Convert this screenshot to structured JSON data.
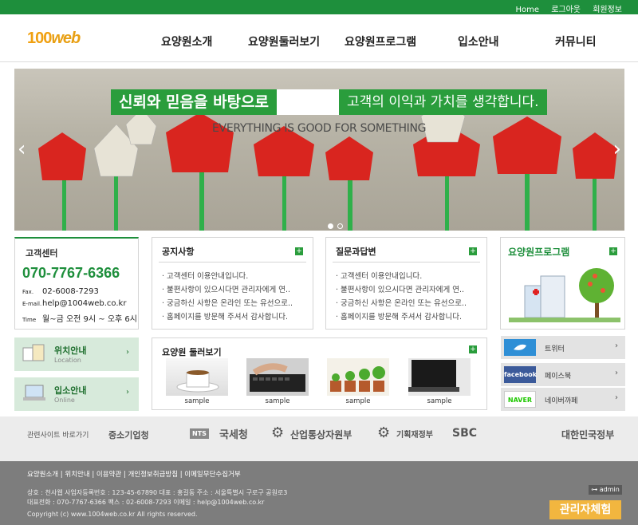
{
  "top_links": [
    "Home",
    "로그아웃",
    "회원정보"
  ],
  "logo": {
    "num": "100",
    "web": "web"
  },
  "nav": [
    "요양원소개",
    "요양원둘러보기",
    "요양원프로그램",
    "입소안내",
    "커뮤니티"
  ],
  "banner": {
    "headline_a": "신뢰와 믿음을 바탕으로",
    "headline_b": "고객의 이익과 가치를 생각합니다.",
    "sub": "EVERYTHING IS GOOD FOR SOMETHING"
  },
  "customer_center": {
    "title": "고객센터",
    "phone": "070-7767-6366",
    "fax_label": "Fax.",
    "fax": "02-6008-7293",
    "email_label": "E-mail.",
    "email": "help@1004web.co.kr",
    "time_label": "Time",
    "time": "월~금 오전 9시 ~ 오후 6시"
  },
  "location": {
    "title": "위치안내",
    "sub": "Location",
    "chevron": "›"
  },
  "admission": {
    "title": "입소안내",
    "sub": "Online",
    "chevron": "›"
  },
  "notice": {
    "title": "공지사항",
    "plus": "+",
    "items": [
      "· 고객센터 이용안내입니다.",
      "· 불편사항이 있으시다면 관리자에게 연..",
      "· 궁금하신 사항은 온라인 또는 유선으로..",
      "· 홈페이지를 방문해 주셔서 감사합니다."
    ]
  },
  "qna": {
    "title": "질문과답변",
    "plus": "+",
    "items": [
      "· 고객센터 이용안내입니다.",
      "· 불편사항이 있으시다면 관리자에게 연..",
      "· 궁금하신 사항은 온라인 또는 유선으로..",
      "· 홈페이지를 방문해 주셔서 감사합니다."
    ]
  },
  "program": {
    "title": "요양원프로그램",
    "plus": "+"
  },
  "gallery": {
    "title": "요양원 둘러보기",
    "plus": "+",
    "captions": [
      "sample",
      "sample",
      "sample",
      "sample"
    ]
  },
  "social": [
    {
      "label": "트위터",
      "chevron": "›",
      "logo": "twitter"
    },
    {
      "label": "페이스북",
      "chevron": "›",
      "logo": "facebook"
    },
    {
      "label": "네이버까페",
      "chevron": "›",
      "logo": "NAVER"
    }
  ],
  "related": {
    "label": "관련사이트 바로가기",
    "sites": [
      "중소기업청",
      "국세청",
      "산업통상자원부",
      "기획재정부",
      "SBC",
      "대한민국정부"
    ],
    "nts": "NTS"
  },
  "footer": {
    "links": "요양원소개 | 위치안내 | 이용약관 | 개인정보취급방침 | 이메일무단수집거부",
    "line1": "상호 : 천사웹   사업자등록번호 : 123-45-67890  대표 : 홍길동   주소 : 서울특별시 구로구 공원로3",
    "line2": "대표전화 : 070-7767-6366  팩스 : 02-6008-7293  이메일 : help@1004web.co.kr",
    "copyright": "Copyright (c) www.1004web.co.kr All rights reserved.",
    "admin": "admin",
    "admin_trial": "관리자체험"
  },
  "colors": {
    "green": "#1e8f3c",
    "accent": "#2a9d3c"
  }
}
